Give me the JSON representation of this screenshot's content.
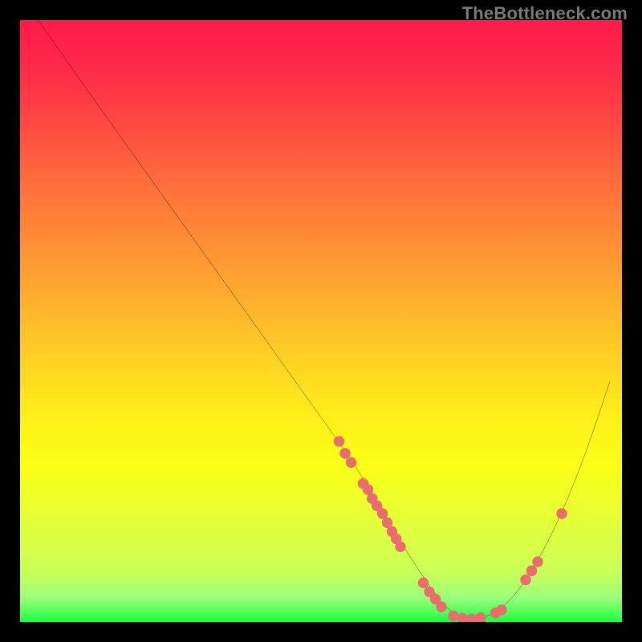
{
  "attribution": "TheBottleneck.com",
  "chart_data": {
    "type": "line",
    "title": "",
    "xlabel": "",
    "ylabel": "",
    "xlim": [
      0,
      100
    ],
    "ylim": [
      0,
      100
    ],
    "grid": false,
    "legend": false,
    "series": [
      {
        "name": "curve",
        "color": "#000000",
        "x": [
          3,
          10,
          20,
          30,
          40,
          50,
          55,
          60,
          64,
          68,
          71,
          74,
          78,
          82,
          86,
          90,
          94,
          98
        ],
        "y": [
          100,
          90,
          76,
          62,
          48,
          34,
          27,
          19,
          12,
          6,
          2,
          0.5,
          0.8,
          4,
          10,
          18,
          28,
          40
        ]
      }
    ],
    "markers": [
      {
        "name": "cluster-left-top",
        "x": 53,
        "y": 30,
        "color": "#e86d6d"
      },
      {
        "name": "cluster-left-top-2",
        "x": 54,
        "y": 28,
        "color": "#e86d6d"
      },
      {
        "name": "cluster-left-top-3",
        "x": 55,
        "y": 26.5,
        "color": "#e86d6d"
      },
      {
        "name": "cluster-left-mid",
        "x": 57,
        "y": 23,
        "color": "#e86d6d"
      },
      {
        "name": "cluster-left-mid-2",
        "x": 57.8,
        "y": 22,
        "color": "#e86d6d"
      },
      {
        "name": "cluster-left-mid-3",
        "x": 58.5,
        "y": 20.5,
        "color": "#e86d6d"
      },
      {
        "name": "cluster-left-mid-4",
        "x": 59.3,
        "y": 19.3,
        "color": "#e86d6d"
      },
      {
        "name": "cluster-left-mid-5",
        "x": 60.2,
        "y": 18,
        "color": "#e86d6d"
      },
      {
        "name": "cluster-left-mid-6",
        "x": 61,
        "y": 16.5,
        "color": "#e86d6d"
      },
      {
        "name": "cluster-left-low",
        "x": 61.8,
        "y": 15,
        "color": "#e86d6d"
      },
      {
        "name": "cluster-left-low-2",
        "x": 62.5,
        "y": 13.8,
        "color": "#e86d6d"
      },
      {
        "name": "cluster-left-low-3",
        "x": 63.2,
        "y": 12.5,
        "color": "#e86d6d"
      },
      {
        "name": "bottom-1",
        "x": 67,
        "y": 6.5,
        "color": "#e86d6d"
      },
      {
        "name": "bottom-2",
        "x": 68,
        "y": 5,
        "color": "#e86d6d"
      },
      {
        "name": "bottom-3",
        "x": 69,
        "y": 3.8,
        "color": "#e86d6d"
      },
      {
        "name": "bottom-4",
        "x": 70,
        "y": 2.5,
        "color": "#e86d6d"
      },
      {
        "name": "bottom-5",
        "x": 72,
        "y": 1,
        "color": "#e86d6d"
      },
      {
        "name": "bottom-6",
        "x": 73.5,
        "y": 0.6,
        "color": "#e86d6d"
      },
      {
        "name": "bottom-7",
        "x": 75,
        "y": 0.5,
        "color": "#e86d6d"
      },
      {
        "name": "bottom-8",
        "x": 76.5,
        "y": 0.7,
        "color": "#e86d6d"
      },
      {
        "name": "bottom-9",
        "x": 79,
        "y": 1.5,
        "color": "#e86d6d"
      },
      {
        "name": "bottom-10",
        "x": 80,
        "y": 2,
        "color": "#e86d6d"
      },
      {
        "name": "right-low-1",
        "x": 84,
        "y": 7,
        "color": "#e86d6d"
      },
      {
        "name": "right-low-2",
        "x": 85,
        "y": 8.5,
        "color": "#e86d6d"
      },
      {
        "name": "right-low-3",
        "x": 86,
        "y": 10,
        "color": "#e86d6d"
      },
      {
        "name": "right-high",
        "x": 90,
        "y": 18,
        "color": "#e86d6d"
      }
    ]
  }
}
